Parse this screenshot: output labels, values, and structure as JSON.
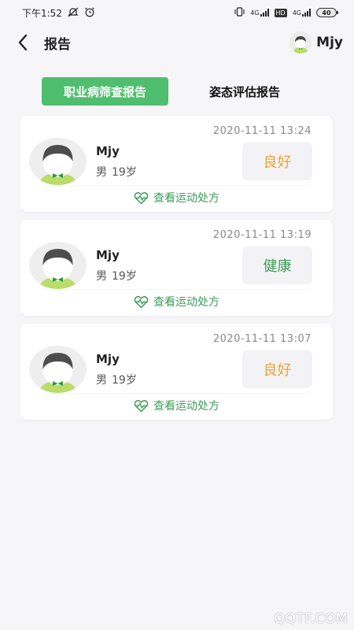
{
  "status_bar": {
    "time": "下午1:52",
    "icons": [
      "mute-icon",
      "alarm-icon",
      "vibrate-icon",
      "signal-icon",
      "hd-icon",
      "signal-icon"
    ],
    "net_label_1": "4G",
    "hd_label": "HD",
    "net_label_2": "4G",
    "battery": "40"
  },
  "header": {
    "title": "报告",
    "username": "Mjy"
  },
  "tabs": [
    {
      "label": "职业病筛查报告",
      "active": true
    },
    {
      "label": "姿态评估报告",
      "active": false
    }
  ],
  "reports": [
    {
      "name": "Mjy",
      "gender": "男",
      "age": "19岁",
      "time": "2020-11-11 13:24",
      "status": "良好",
      "status_color": "#e9a43c",
      "link": "查看运动处方"
    },
    {
      "name": "Mjy",
      "gender": "男",
      "age": "19岁",
      "time": "2020-11-11 13:19",
      "status": "健康",
      "status_color": "#3c9c5a",
      "link": "查看运动处方"
    },
    {
      "name": "Mjy",
      "gender": "男",
      "age": "19岁",
      "time": "2020-11-11 13:07",
      "status": "良好",
      "status_color": "#e9a43c",
      "link": "查看运动处方"
    }
  ],
  "colors": {
    "accent": "#4fbe6e",
    "link": "#3c9c5a"
  },
  "watermark": "QQTF.COM"
}
